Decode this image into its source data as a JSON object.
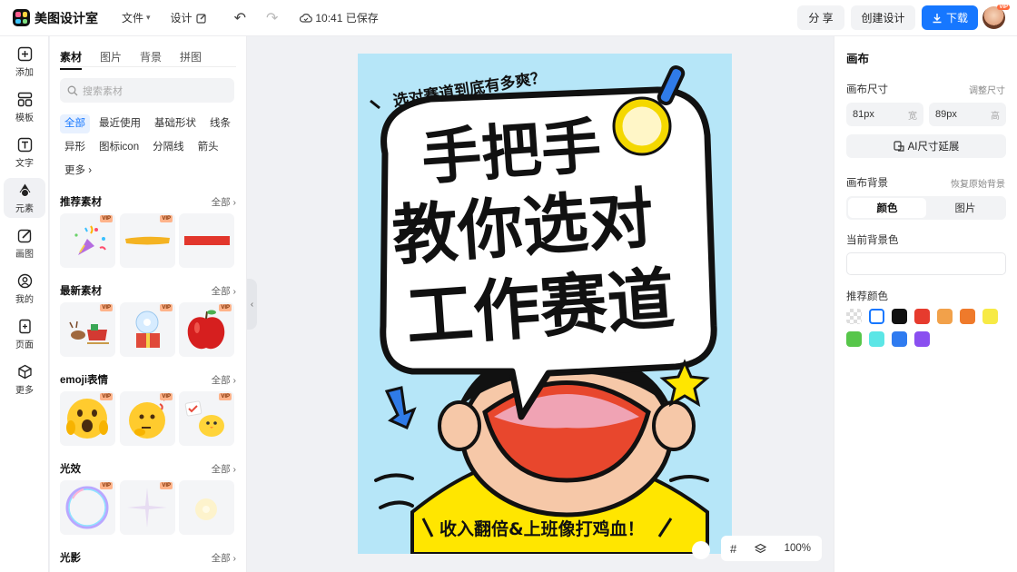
{
  "app": {
    "name": "美图设计室"
  },
  "topbar": {
    "file_menu": "文件",
    "design_menu": "设计",
    "saved_status": "10:41 已保存",
    "share_button": "分 享",
    "create_button": "创建设计",
    "download_button": "下载",
    "avatar_badge": "VIP"
  },
  "rail": {
    "items": [
      {
        "label": "添加",
        "icon": "plus-square-icon"
      },
      {
        "label": "模板",
        "icon": "template-icon"
      },
      {
        "label": "文字",
        "icon": "text-icon"
      },
      {
        "label": "元素",
        "icon": "shapes-icon"
      },
      {
        "label": "画图",
        "icon": "draw-icon"
      },
      {
        "label": "我的",
        "icon": "user-icon"
      },
      {
        "label": "页面",
        "icon": "page-icon"
      },
      {
        "label": "更多",
        "icon": "cube-icon"
      }
    ],
    "active": "元素"
  },
  "panel": {
    "tabs": [
      "素材",
      "图片",
      "背景",
      "拼图"
    ],
    "search_placeholder": "搜索素材",
    "chips": [
      "全部",
      "最近使用",
      "基础形状",
      "线条",
      "异形",
      "图标icon",
      "分隔线",
      "箭头",
      "更多"
    ],
    "vip_label": "VIP",
    "all_label": "全部",
    "sections": [
      {
        "title": "推荐素材",
        "items": [
          "party-popper",
          "yellow-brush-stroke",
          "red-bar"
        ]
      },
      {
        "title": "最新素材",
        "items": [
          "reindeer-sleigh",
          "snow-globe-gift",
          "red-apple"
        ]
      },
      {
        "title": "emoji表情",
        "items": [
          "shocked-emoji",
          "thinking-emoji",
          "chick-emoji"
        ]
      },
      {
        "title": "光效",
        "items": [
          "bubble-ring",
          "star-sparkle",
          "glow-dot"
        ]
      },
      {
        "title": "光影",
        "items": []
      }
    ]
  },
  "poster": {
    "subtitle": "选对赛道到底有多爽？",
    "title_lines": [
      "手把手",
      "教你选对",
      "工作赛道"
    ],
    "footer": "收入翻倍&上班像打鸡血！",
    "colors": {
      "background": "#b6e6f8",
      "bubble": "#ffffff",
      "shirt": "#ffe600",
      "mouth": "#e8472d",
      "tongue": "#f0a3b4"
    }
  },
  "canvas_bar": {
    "zoom": "100%"
  },
  "rpanel": {
    "title": "画布",
    "size_label": "画布尺寸",
    "size_link": "调整尺寸",
    "width_value": "81px",
    "width_unit": "宽",
    "height_value": "89px",
    "height_unit": "高",
    "ai_button": "AI尺寸延展",
    "bg_label": "画布背景",
    "bg_link": "恢复原始背景",
    "seg": [
      "颜色",
      "图片"
    ],
    "current_bg_label": "当前背景色",
    "recommend_label": "推荐颜色",
    "swatches": [
      "transparent",
      "#ffffff",
      "#111111",
      "#e63b2e",
      "#f2a14a",
      "#ef7a2b",
      "#f7ea45",
      "#57c64a",
      "#5ce6e6",
      "#2f7bf0",
      "#8a4ff0"
    ]
  },
  "accent": "#1677ff"
}
